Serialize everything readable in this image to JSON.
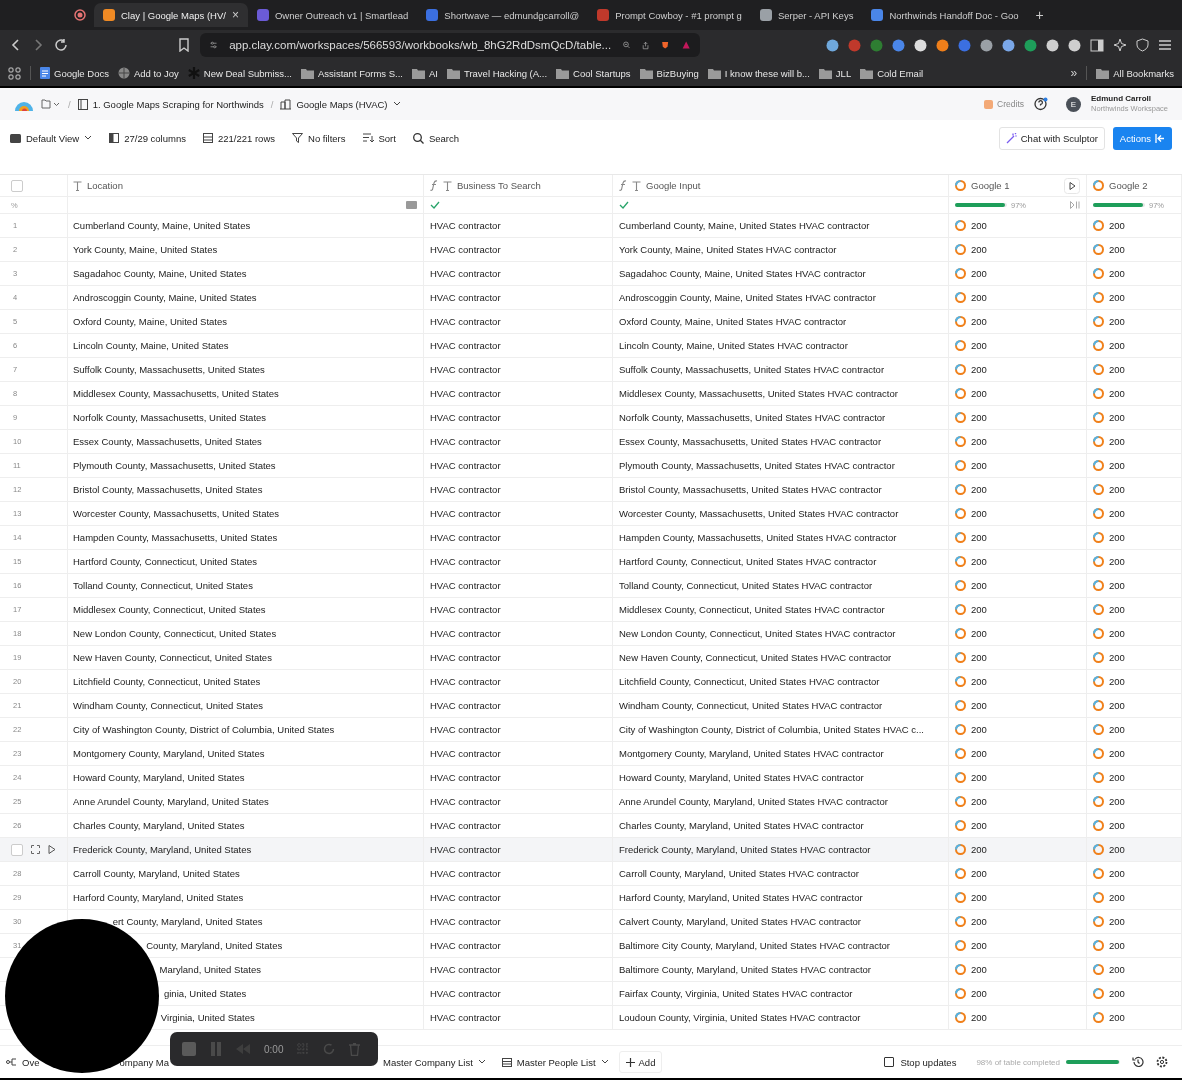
{
  "browser": {
    "tabs": [
      {
        "title": "Clay | Google Maps (HV/",
        "selected": true,
        "color": "#f08a24",
        "close": "×"
      },
      {
        "title": "Owner Outreach v1 | Smartlead",
        "selected": false,
        "color": "#6b5bd6"
      },
      {
        "title": "Shortwave — edmundgcarroll@",
        "selected": false,
        "color": "#3b6fe0"
      },
      {
        "title": "Prompt Cowboy - #1 prompt g",
        "selected": false,
        "color": "#c0392b"
      },
      {
        "title": "Serper - API Keys",
        "selected": false,
        "color": "#9aa0a6"
      },
      {
        "title": "Northwinds Handoff Doc - Goo",
        "selected": false,
        "color": "#4a86e8"
      }
    ],
    "new_tab": "+",
    "address": "app.clay.com/workspaces/566593/workbooks/wb_8hG2RdDsmQcD/table...",
    "bookmarks": [
      {
        "label": "Google Docs",
        "kind": "doc"
      },
      {
        "label": "Add to Joy",
        "kind": "globe"
      },
      {
        "label": "New Deal Submiss...",
        "kind": "star"
      },
      {
        "label": "Assistant Forms S...",
        "kind": "folder"
      },
      {
        "label": "AI",
        "kind": "folder"
      },
      {
        "label": "Travel Hacking (A...",
        "kind": "folder"
      },
      {
        "label": "Cool Startups",
        "kind": "folder"
      },
      {
        "label": "BizBuying",
        "kind": "folder"
      },
      {
        "label": "I know these will b...",
        "kind": "folder"
      },
      {
        "label": "JLL",
        "kind": "folder"
      },
      {
        "label": "Cold Email",
        "kind": "folder"
      }
    ],
    "more": "»",
    "all_bookmarks": "All Bookmarks"
  },
  "app": {
    "breadcrumb": [
      "1. Google Maps Scraping for Northwinds",
      "Google Maps (HVAC)"
    ],
    "separator": "/",
    "credits": "Credits",
    "user": {
      "initial": "E",
      "name": "Edmund Carroll",
      "workspace": "Northwinds Workspace"
    }
  },
  "toolbar": {
    "items": [
      {
        "label": "Default View",
        "kind": "view"
      },
      {
        "label": "27/29 columns",
        "kind": "columns"
      },
      {
        "label": "221/221 rows",
        "kind": "rows"
      },
      {
        "label": "No filters",
        "kind": "filter"
      },
      {
        "label": "Sort",
        "kind": "sort"
      },
      {
        "label": "Search",
        "kind": "search"
      }
    ],
    "chat": "Chat with Sculptor",
    "actions": "Actions"
  },
  "table": {
    "select_all": {
      "checked": false
    },
    "columns": [
      {
        "label": "Location",
        "kind": "text"
      },
      {
        "label": "Business To Search",
        "kind": "formula"
      },
      {
        "label": "Google Input",
        "kind": "formula"
      },
      {
        "label": "Google 1",
        "kind": "enrich"
      },
      {
        "label": "Google 2",
        "kind": "enrich"
      }
    ],
    "fill_row": {
      "marker": "%",
      "google_1": {
        "level": 0.97,
        "reading": "97%"
      },
      "google_2": {
        "level": 0.97,
        "reading": "97%"
      }
    },
    "rows": [
      {
        "num": "1",
        "location": "Cumberland County, Maine, United States",
        "business": "HVAC contractor",
        "input": "Cumberland County, Maine, United States HVAC contractor",
        "google_1": "200",
        "google_2": "200",
        "hovered": false
      },
      {
        "num": "2",
        "location": "York County, Maine, United States",
        "business": "HVAC contractor",
        "input": "York County, Maine, United States HVAC contractor",
        "google_1": "200",
        "google_2": "200",
        "hovered": false
      },
      {
        "num": "3",
        "location": "Sagadahoc County, Maine, United States",
        "business": "HVAC contractor",
        "input": "Sagadahoc County, Maine, United States HVAC contractor",
        "google_1": "200",
        "google_2": "200",
        "hovered": false
      },
      {
        "num": "4",
        "location": "Androscoggin County, Maine, United States",
        "business": "HVAC contractor",
        "input": "Androscoggin County, Maine, United States HVAC contractor",
        "google_1": "200",
        "google_2": "200",
        "hovered": false
      },
      {
        "num": "5",
        "location": "Oxford County, Maine, United States",
        "business": "HVAC contractor",
        "input": "Oxford County, Maine, United States HVAC contractor",
        "google_1": "200",
        "google_2": "200",
        "hovered": false
      },
      {
        "num": "6",
        "location": "Lincoln County, Maine, United States",
        "business": "HVAC contractor",
        "input": "Lincoln County, Maine, United States HVAC contractor",
        "google_1": "200",
        "google_2": "200",
        "hovered": false
      },
      {
        "num": "7",
        "location": "Suffolk County, Massachusetts, United States",
        "business": "HVAC contractor",
        "input": "Suffolk County, Massachusetts, United States HVAC contractor",
        "google_1": "200",
        "google_2": "200",
        "hovered": false
      },
      {
        "num": "8",
        "location": "Middlesex County, Massachusetts, United States",
        "business": "HVAC contractor",
        "input": "Middlesex County, Massachusetts, United States HVAC contractor",
        "google_1": "200",
        "google_2": "200",
        "hovered": false
      },
      {
        "num": "9",
        "location": "Norfolk County, Massachusetts, United States",
        "business": "HVAC contractor",
        "input": "Norfolk County, Massachusetts, United States HVAC contractor",
        "google_1": "200",
        "google_2": "200",
        "hovered": false
      },
      {
        "num": "10",
        "location": "Essex County, Massachusetts, United States",
        "business": "HVAC contractor",
        "input": "Essex County, Massachusetts, United States HVAC contractor",
        "google_1": "200",
        "google_2": "200",
        "hovered": false
      },
      {
        "num": "11",
        "location": "Plymouth County, Massachusetts, United States",
        "business": "HVAC contractor",
        "input": "Plymouth County, Massachusetts, United States HVAC contractor",
        "google_1": "200",
        "google_2": "200",
        "hovered": false
      },
      {
        "num": "12",
        "location": "Bristol County, Massachusetts, United States",
        "business": "HVAC contractor",
        "input": "Bristol County, Massachusetts, United States HVAC contractor",
        "google_1": "200",
        "google_2": "200",
        "hovered": false
      },
      {
        "num": "13",
        "location": "Worcester County, Massachusetts, United States",
        "business": "HVAC contractor",
        "input": "Worcester County, Massachusetts, United States HVAC contractor",
        "google_1": "200",
        "google_2": "200",
        "hovered": false
      },
      {
        "num": "14",
        "location": "Hampden County, Massachusetts, United States",
        "business": "HVAC contractor",
        "input": "Hampden County, Massachusetts, United States HVAC contractor",
        "google_1": "200",
        "google_2": "200",
        "hovered": false
      },
      {
        "num": "15",
        "location": "Hartford County, Connecticut, United States",
        "business": "HVAC contractor",
        "input": "Hartford County, Connecticut, United States HVAC contractor",
        "google_1": "200",
        "google_2": "200",
        "hovered": false
      },
      {
        "num": "16",
        "location": "Tolland County, Connecticut, United States",
        "business": "HVAC contractor",
        "input": "Tolland County, Connecticut, United States HVAC contractor",
        "google_1": "200",
        "google_2": "200",
        "hovered": false
      },
      {
        "num": "17",
        "location": "Middlesex County, Connecticut, United States",
        "business": "HVAC contractor",
        "input": "Middlesex County, Connecticut, United States HVAC contractor",
        "google_1": "200",
        "google_2": "200",
        "hovered": false
      },
      {
        "num": "18",
        "location": "New London County, Connecticut, United States",
        "business": "HVAC contractor",
        "input": "New London County, Connecticut, United States HVAC contractor",
        "google_1": "200",
        "google_2": "200",
        "hovered": false
      },
      {
        "num": "19",
        "location": "New Haven County, Connecticut, United States",
        "business": "HVAC contractor",
        "input": "New Haven County, Connecticut, United States HVAC contractor",
        "google_1": "200",
        "google_2": "200",
        "hovered": false
      },
      {
        "num": "20",
        "location": "Litchfield County, Connecticut, United States",
        "business": "HVAC contractor",
        "input": "Litchfield County, Connecticut, United States HVAC contractor",
        "google_1": "200",
        "google_2": "200",
        "hovered": false
      },
      {
        "num": "21",
        "location": "Windham County, Connecticut, United States",
        "business": "HVAC contractor",
        "input": "Windham County, Connecticut, United States HVAC contractor",
        "google_1": "200",
        "google_2": "200",
        "hovered": false
      },
      {
        "num": "22",
        "location": "City of Washington County, District of Columbia, United States",
        "business": "HVAC contractor",
        "input": "City of Washington County, District of Columbia, United States HVAC c...",
        "google_1": "200",
        "google_2": "200",
        "hovered": false
      },
      {
        "num": "23",
        "location": "Montgomery County, Maryland, United States",
        "business": "HVAC contractor",
        "input": "Montgomery County, Maryland, United States HVAC contractor",
        "google_1": "200",
        "google_2": "200",
        "hovered": false
      },
      {
        "num": "24",
        "location": "Howard County, Maryland, United States",
        "business": "HVAC contractor",
        "input": "Howard County, Maryland, United States HVAC contractor",
        "google_1": "200",
        "google_2": "200",
        "hovered": false
      },
      {
        "num": "25",
        "location": "Anne Arundel County, Maryland, United States",
        "business": "HVAC contractor",
        "input": "Anne Arundel County, Maryland, United States HVAC contractor",
        "google_1": "200",
        "google_2": "200",
        "hovered": false
      },
      {
        "num": "26",
        "location": "Charles County, Maryland, United States",
        "business": "HVAC contractor",
        "input": "Charles County, Maryland, United States HVAC contractor",
        "google_1": "200",
        "google_2": "200",
        "hovered": false
      },
      {
        "location": "Frederick County, Maryland, United States",
        "business": "HVAC contractor",
        "input": "Frederick County, Maryland, United States HVAC contractor",
        "google_1": "200",
        "google_2": "200",
        "hovered": true
      },
      {
        "num": "28",
        "location": "Carroll County, Maryland, United States",
        "business": "HVAC contractor",
        "input": "Carroll County, Maryland, United States HVAC contractor",
        "google_1": "200",
        "google_2": "200",
        "hovered": false
      },
      {
        "num": "29",
        "location": "Harford County, Maryland, United States",
        "business": "HVAC contractor",
        "input": "Harford County, Maryland, United States HVAC contractor",
        "google_1": "200",
        "google_2": "200",
        "hovered": false
      },
      {
        "num": "30",
        "location": "ert County, Maryland, United States",
        "business": "HVAC contractor",
        "input": "Calvert County, Maryland, United States HVAC contractor",
        "google_1": "200",
        "google_2": "200",
        "hovered": false
      },
      {
        "num": "31",
        "location": "County, Maryland, United States",
        "business": "HVAC contractor",
        "input": "Baltimore City County, Maryland, United States HVAC contractor",
        "google_1": "200",
        "google_2": "200",
        "hovered": false
      },
      {
        "location": "Maryland, United States",
        "business": "HVAC contractor",
        "input": "Baltimore County, Maryland, United States HVAC contractor",
        "google_1": "200",
        "google_2": "200"
      },
      {
        "location": "ginia, United States",
        "business": "HVAC contractor",
        "input": "Fairfax County, Virginia, United States HVAC contractor",
        "google_1": "200",
        "google_2": "200"
      },
      {
        "location": "Virginia, United States",
        "business": "HVAC contractor",
        "input": "Loudoun County, Virginia, United States HVAC contractor",
        "google_1": "200",
        "google_2": "200"
      }
    ]
  },
  "bottom": {
    "tabs": [
      {
        "label": "Ove",
        "kind": "flow"
      },
      {
        "label": "ompany Ma",
        "kind": "plain"
      },
      {
        "label": "Master Company List",
        "kind": "caret"
      },
      {
        "label": "Master People List",
        "kind": "table"
      }
    ],
    "add": "Add",
    "stop_updates": {
      "label": "Stop updates",
      "checked": false
    },
    "progress": {
      "label": "98% of table completed",
      "level": 0.98
    }
  },
  "recording": {
    "time": "0:00"
  }
}
